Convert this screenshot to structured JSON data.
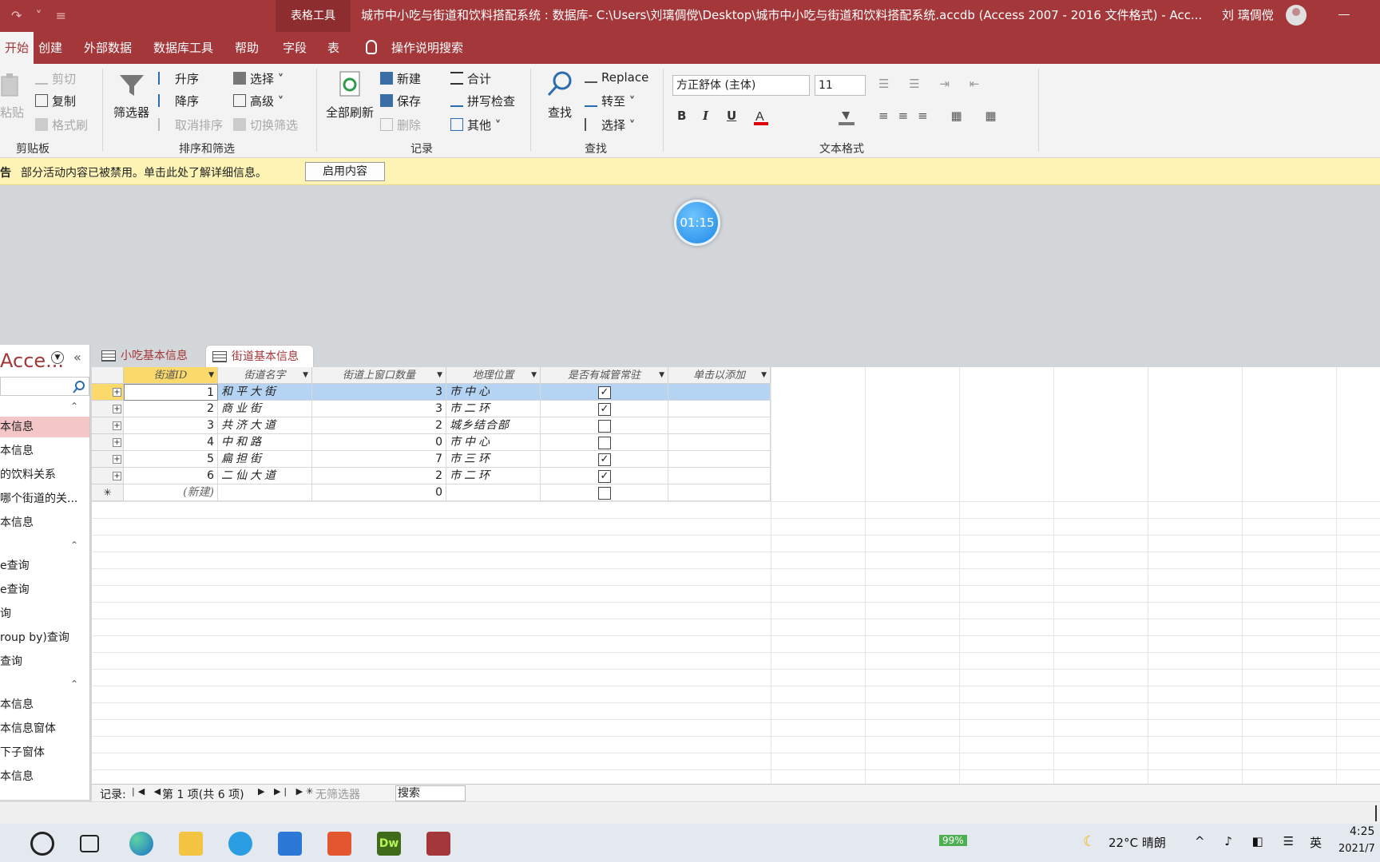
{
  "window": {
    "quick_access": "↷ ˅ ≡",
    "context_tab": "表格工具",
    "title": "城市中小吃与街道和饮料搭配系统 : 数据库- C:\\Users\\刘璃倜傥\\Desktop\\城市中小吃与街道和饮料搭配系统.accdb (Access 2007 - 2016 文件格式)  -  Acc...",
    "user": "刘 璃倜傥"
  },
  "tabs": [
    "开始",
    "创建",
    "外部数据",
    "数据库工具",
    "帮助",
    "字段",
    "表"
  ],
  "tell_me": "操作说明搜索",
  "ribbon": {
    "clipboard": {
      "paste": "粘贴",
      "cut": "剪切",
      "copy": "复制",
      "format_painter": "格式刷",
      "group": "剪贴板"
    },
    "sort_filter": {
      "filter": "筛选器",
      "asc": "升序",
      "desc": "降序",
      "remove_sort": "取消排序",
      "selection": "选择 ˅",
      "advanced": "高级 ˅",
      "toggle_filter": "切换筛选",
      "group": "排序和筛选"
    },
    "records": {
      "refresh_all": "全部刷新",
      "new": "新建",
      "save": "保存",
      "delete": "删除",
      "totals": "合计",
      "spelling": "拼写检查",
      "more": "其他 ˅",
      "group": "记录"
    },
    "find": {
      "find": "查找",
      "replace": "Replace",
      "goto": "转至 ˅",
      "select": "选择 ˅",
      "group": "查找"
    },
    "text_format": {
      "font": "方正舒体 (主体)",
      "size": "11",
      "bold": "B",
      "italic": "I",
      "underline": "U",
      "group": "文本格式"
    }
  },
  "message_bar": {
    "label": "告",
    "text": "部分活动内容已被禁用。单击此处了解详细信息。",
    "button": "启用内容"
  },
  "timer": "01:15",
  "nav_pane": {
    "title": "Acce...",
    "items": [
      {
        "label": "本信息",
        "selected": true
      },
      {
        "label": "本信息"
      },
      {
        "label": "的饮料关系"
      },
      {
        "label": "哪个街道的关..."
      },
      {
        "label": "本信息"
      },
      {
        "label": "e查询"
      },
      {
        "label": "e查询"
      },
      {
        "label": "询"
      },
      {
        "label": "roup by)查询"
      },
      {
        "label": "查询"
      },
      {
        "label": "本信息"
      },
      {
        "label": "本信息窗体"
      },
      {
        "label": "下子窗体"
      },
      {
        "label": "本信息"
      }
    ]
  },
  "doc_tabs": [
    "小吃基本信息",
    "街道基本信息"
  ],
  "table": {
    "columns": [
      "街道ID",
      "街道名字",
      "街道上窗口数量",
      "地理位置",
      "是否有城管常驻",
      "单击以添加"
    ],
    "rows": [
      {
        "id": "1",
        "name": "和平大街",
        "windows": "3",
        "location": "市中心",
        "chengguan": true
      },
      {
        "id": "2",
        "name": "商业街",
        "windows": "3",
        "location": "市二环",
        "chengguan": true
      },
      {
        "id": "3",
        "name": "共济大道",
        "windows": "2",
        "location": "城乡结合部",
        "chengguan": false
      },
      {
        "id": "4",
        "name": "中和路",
        "windows": "0",
        "location": "市中心",
        "chengguan": false
      },
      {
        "id": "5",
        "name": "扁担街",
        "windows": "7",
        "location": "市三环",
        "chengguan": true
      },
      {
        "id": "6",
        "name": "二仙大道",
        "windows": "2",
        "location": "市二环",
        "chengguan": true
      }
    ],
    "new_row": {
      "id": "(新建)",
      "windows": "0"
    }
  },
  "record_nav": {
    "label": "记录:",
    "position": "第 1 项(共 6 项)",
    "no_filter": "无筛选器",
    "search": "搜索"
  },
  "taskbar": {
    "battery": "99%",
    "weather": "22°C  晴朗",
    "ime": "英",
    "time": "4:25",
    "date": "2021/7"
  }
}
